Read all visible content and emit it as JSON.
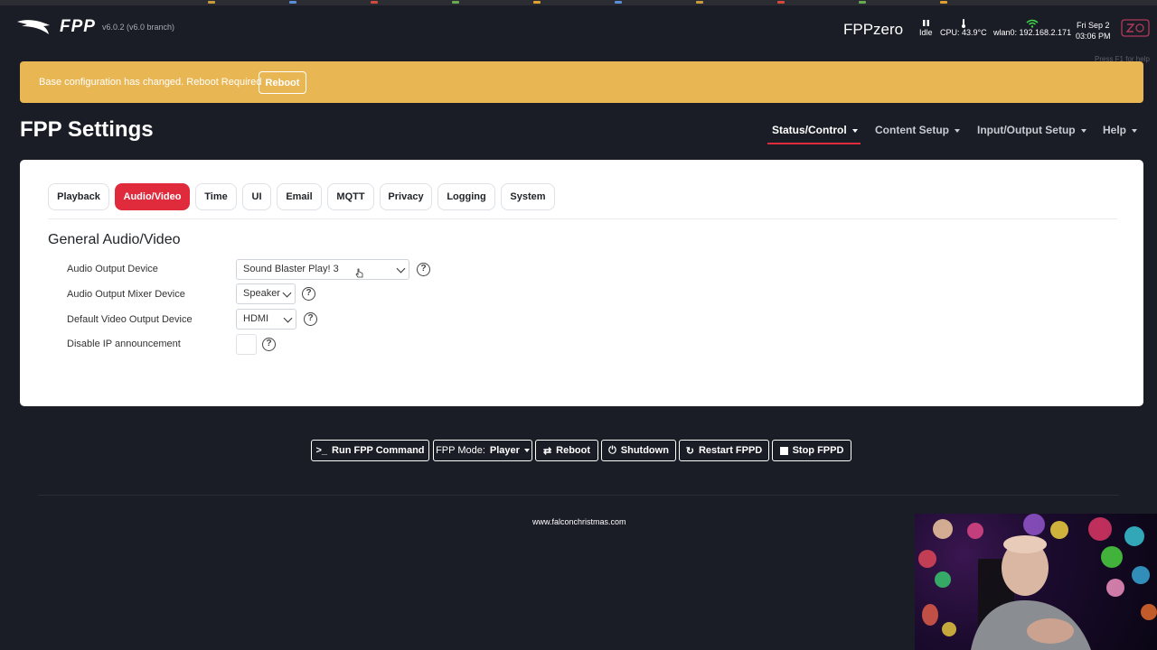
{
  "app": {
    "logo_text": "FPP",
    "version": "v6.0.2 (v6.0 branch)",
    "hostname": "FPPzero",
    "status": "Idle",
    "cpu": "CPU: 43.9°C",
    "wlan": "wlan0: 192.168.2.171",
    "date": "Fri Sep 2",
    "time": "03:06 PM",
    "help_hint": "Press F1 for help"
  },
  "alert": {
    "message": "Base configuration has changed. Reboot Required",
    "button": "Reboot"
  },
  "page_title": "FPP Settings",
  "nav": [
    "Status/Control",
    "Content Setup",
    "Input/Output Setup",
    "Help"
  ],
  "tabs": [
    "Playback",
    "Audio/Video",
    "Time",
    "UI",
    "Email",
    "MQTT",
    "Privacy",
    "Logging",
    "System"
  ],
  "active_tab": "Audio/Video",
  "section_title": "General Audio/Video",
  "settings": {
    "audio_output_device": {
      "label": "Audio Output Device",
      "value": "Sound Blaster Play! 3"
    },
    "audio_mixer_device": {
      "label": "Audio Output Mixer Device",
      "value": "Speaker"
    },
    "video_output_device": {
      "label": "Default Video Output Device",
      "value": "HDMI"
    },
    "disable_ip": {
      "label": "Disable IP announcement",
      "checked": false
    }
  },
  "actions": {
    "run_command": "Run FPP Command",
    "mode_label": "FPP Mode:",
    "mode_value": "Player",
    "reboot": "Reboot",
    "shutdown": "Shutdown",
    "restart": "Restart FPPD",
    "stop": "Stop FPPD"
  },
  "footer_link": "www.falconchristmas.com",
  "colors": {
    "background": "#1b1d26",
    "alert": "#e8b653",
    "accent": "#e02b3c",
    "card": "#ffffff"
  }
}
